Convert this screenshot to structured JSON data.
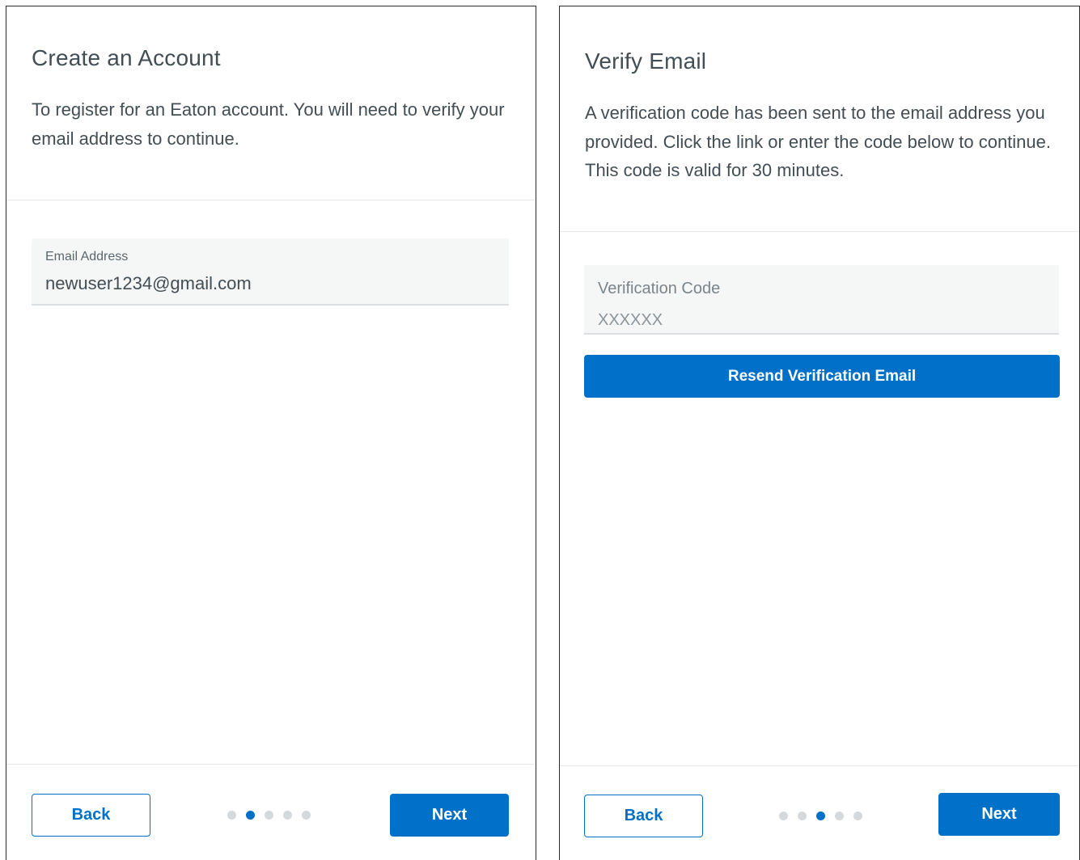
{
  "create_account": {
    "title": "Create an Account",
    "description": "To register for an Eaton account. You will need to verify your email address to continue.",
    "email_field": {
      "label": "Email Address",
      "value": "newuser1234@gmail.com"
    },
    "back_label": "Back",
    "next_label": "Next",
    "steps": {
      "total": 5,
      "active": 2
    }
  },
  "verify_email": {
    "title": "Verify Email",
    "description": "A verification code has been sent to the email address you provided. Click the link or enter the code below to continue. This code is valid for 30 minutes.",
    "code_field": {
      "label": "Verification Code",
      "placeholder": "XXXXXX"
    },
    "resend_label": "Resend Verification Email",
    "back_label": "Back",
    "next_label": "Next",
    "steps": {
      "total": 5,
      "active": 3
    }
  },
  "colors": {
    "primary": "#0070c8",
    "text": "#424e54",
    "field_bg": "#f5f6f6",
    "dot_inactive": "#d6d9db"
  }
}
